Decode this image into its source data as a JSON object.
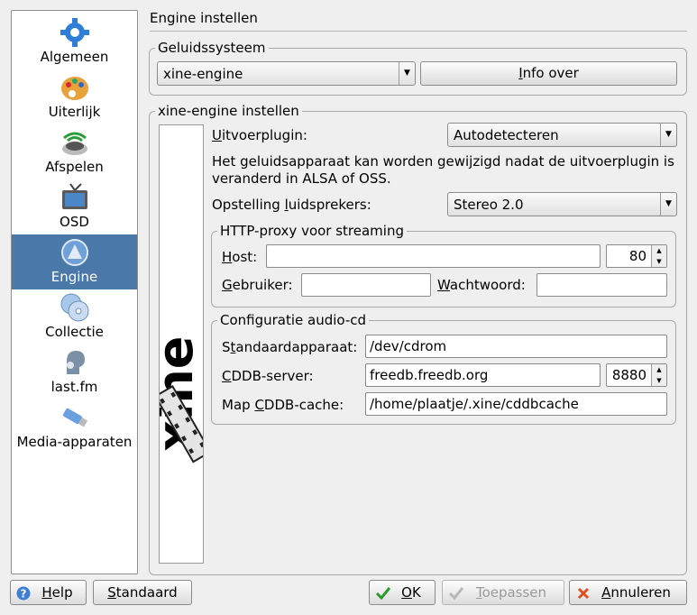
{
  "sidebar": {
    "items": [
      {
        "label": "Algemeen",
        "icon": "gear-icon"
      },
      {
        "label": "Uiterlijk",
        "icon": "palette-icon"
      },
      {
        "label": "Afspelen",
        "icon": "speaker-icon"
      },
      {
        "label": "OSD",
        "icon": "tv-icon"
      },
      {
        "label": "Engine",
        "icon": "engine-icon"
      },
      {
        "label": "Collectie",
        "icon": "disc-collection-icon"
      },
      {
        "label": "last.fm",
        "icon": "lastfm-icon"
      },
      {
        "label": "Media-apparaten",
        "icon": "usb-stick-icon"
      }
    ],
    "active_index": 4
  },
  "page_title": "Engine instellen",
  "sound_system": {
    "legend": "Geluidssysteem",
    "engine_value": "xine-engine",
    "info_button": "Info over",
    "info_button_accel": "I",
    "info_button_rest": "nfo over"
  },
  "xine_settings": {
    "legend": "xine-engine instellen",
    "logo_text": "xine",
    "output_plugin": {
      "label_accel": "U",
      "label_rest": "itvoerplugin:",
      "value": "Autodetecteren"
    },
    "note": "Het geluidsapparaat kan worden gewijzigd nadat de uitvoerplugin is veranderd in ALSA of OSS.",
    "speakers": {
      "label_pre": "Opstelling ",
      "label_accel": "l",
      "label_rest": "uidsprekers:",
      "value": "Stereo 2.0"
    },
    "proxy": {
      "legend": "HTTP-proxy voor streaming",
      "host_label_accel": "H",
      "host_label_rest": "ost:",
      "host_value": "",
      "port_value": "80",
      "user_label_accel": "G",
      "user_label_rest": "ebruiker:",
      "user_value": "",
      "password_label_accel": "W",
      "password_label_rest": "achtwoord:",
      "password_value": ""
    },
    "audio_cd": {
      "legend": "Configuratie audio-cd",
      "device_label_pre": "S",
      "device_label_accel": "t",
      "device_label_rest": "andaardapparaat:",
      "device_value": "/dev/cdrom",
      "cddb_label_pre": "",
      "cddb_label_accel": "C",
      "cddb_label_rest": "DDB-server:",
      "cddb_value": "freedb.freedb.org",
      "cddb_port": "8880",
      "cache_label_pre": "Map ",
      "cache_label_accel": "C",
      "cache_label_rest": "DDB-cache:",
      "cache_value": "/home/plaatje/.xine/cddbcache"
    }
  },
  "buttons": {
    "help": {
      "accel": "H",
      "rest": "elp"
    },
    "defaults": {
      "accel": "S",
      "rest": "tandaard"
    },
    "ok": {
      "accel": "O",
      "rest": "K"
    },
    "apply": {
      "accel": "T",
      "rest": "oepassen"
    },
    "cancel": {
      "accel": "A",
      "rest": "nnuleren"
    }
  },
  "colors": {
    "accent": "#4a78a8",
    "ok_check": "#2e9a2e",
    "cancel_x": "#e0501e",
    "help_icon": "#3d7fd6"
  }
}
